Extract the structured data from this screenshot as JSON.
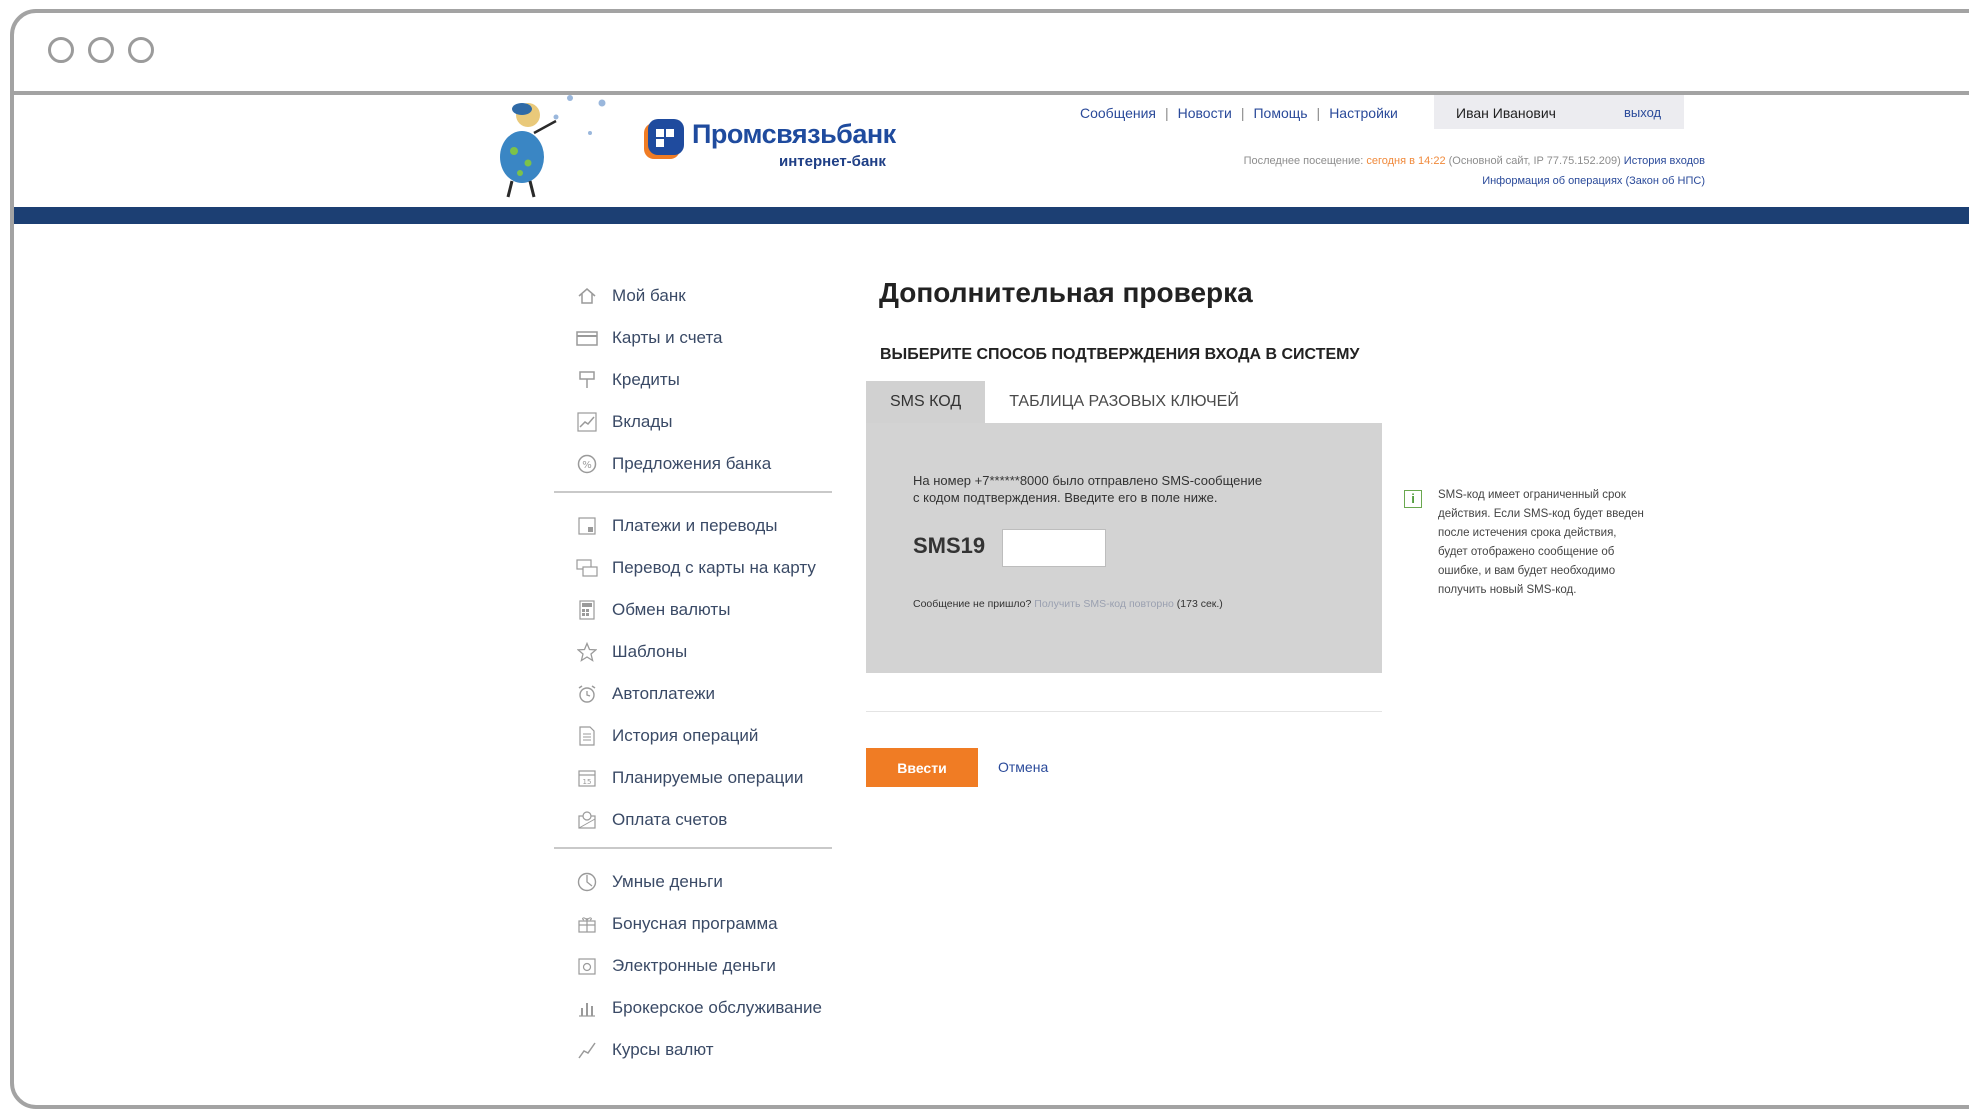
{
  "header": {
    "brand_name": "Промсвязьбанк",
    "brand_sub": "интернет-банк",
    "nav": [
      "Сообщения",
      "Новости",
      "Помощь",
      "Настройки"
    ],
    "user_name": "Иван Иванович",
    "logout": "выход",
    "last_visit_label": "Последнее посещение: ",
    "last_visit_time": "сегодня в 14:22",
    "last_visit_details": " (Основной сайт, IP 77.75.152.209) ",
    "login_history": "История входов",
    "ops_info": "Информация об операциях (Закон об НПС)"
  },
  "sidebar": {
    "group1": [
      {
        "label": "Мой банк",
        "icon": "home-icon"
      },
      {
        "label": "Карты и счета",
        "icon": "card-icon"
      },
      {
        "label": "Кредиты",
        "icon": "credit-icon"
      },
      {
        "label": "Вклады",
        "icon": "deposit-chart-icon"
      },
      {
        "label": "Предложения банка",
        "icon": "percent-icon"
      }
    ],
    "group2": [
      {
        "label": "Платежи и переводы",
        "icon": "payment-icon"
      },
      {
        "label": "Перевод с карты на карту",
        "icon": "card-transfer-icon"
      },
      {
        "label": "Обмен валюты",
        "icon": "calculator-icon"
      },
      {
        "label": "Шаблоны",
        "icon": "star-icon"
      },
      {
        "label": "Автоплатежи",
        "icon": "alarm-clock-icon"
      },
      {
        "label": "История операций",
        "icon": "document-icon"
      },
      {
        "label": "Планируемые операции",
        "icon": "calendar-icon"
      },
      {
        "label": "Оплата счетов",
        "icon": "bill-icon"
      }
    ],
    "group3": [
      {
        "label": "Умные деньги",
        "icon": "pie-clock-icon"
      },
      {
        "label": "Бонусная программа",
        "icon": "gift-icon"
      },
      {
        "label": "Электронные деньги",
        "icon": "wallet-icon"
      },
      {
        "label": "Брокерское обслуживание",
        "icon": "bar-chart-icon"
      },
      {
        "label": "Курсы валют",
        "icon": "line-chart-icon"
      }
    ]
  },
  "main": {
    "title": "Дополнительная проверка",
    "subtitle": "ВЫБЕРИТЕ СПОСОБ ПОДТВЕРЖДЕНИЯ ВХОДА В СИСТЕМУ",
    "tabs": [
      {
        "label": "SMS КОД",
        "active": true
      },
      {
        "label": "ТАБЛИЦА РАЗОВЫХ КЛЮЧЕЙ",
        "active": false
      }
    ],
    "message_line1": "На номер +7******8000 было отправлено SMS-сообщение",
    "message_line2": "с кодом подтверждения. Введите его в поле ниже.",
    "sms_label": "SMS19",
    "sms_value": "",
    "resend_prefix": "Сообщение не пришло? ",
    "resend_link": "Получить SMS-код повторно",
    "resend_timer": "(173 сек.)",
    "submit": "Ввести",
    "cancel": "Отмена"
  },
  "info": {
    "icon": "info-icon",
    "lines": [
      "SMS-код имеет ограниченный срок",
      "действия. Если SMS-код будет введен",
      "после истечения срока действия,",
      "будет отображено сообщение об",
      "ошибке, и вам будет необходимо",
      "получить новый SMS-код."
    ]
  },
  "colors": {
    "accent": "#f07c24",
    "brand_blue": "#1f4b9e",
    "header_bar": "#1c3f73",
    "panel_gray": "#d3d3d3"
  }
}
